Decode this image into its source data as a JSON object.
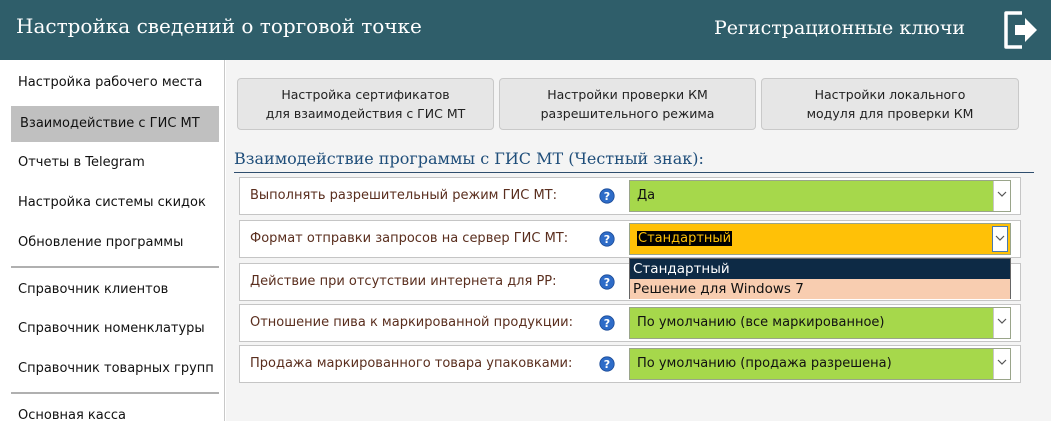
{
  "header": {
    "title": "Настройка сведений о торговой точке",
    "keys_label": "Регистрационные ключи",
    "exit_icon": "exit-door-icon"
  },
  "sidebar": {
    "items": [
      {
        "label": "Настройка рабочего места",
        "active": false
      },
      {
        "label": "Взаимодействие с ГИС МТ",
        "active": true
      },
      {
        "label": "Отчеты в Telegram",
        "active": false
      },
      {
        "label": "Настройка системы скидок",
        "active": false
      },
      {
        "label": "Обновление программы",
        "active": false
      },
      {
        "label": "Справочник клиентов",
        "active": false
      },
      {
        "label": "Справочник номенклатуры",
        "active": false
      },
      {
        "label": "Справочник товарных групп",
        "active": false
      },
      {
        "label": "Основная касса",
        "active": false
      }
    ]
  },
  "tabs": [
    {
      "line1": "Настройка сертификатов",
      "line2": "для взаимодействия с ГИС МТ"
    },
    {
      "line1": "Настройки проверки КМ",
      "line2": "разрешительного режима"
    },
    {
      "line1": "Настройки локального",
      "line2": "модуля для проверки КМ"
    }
  ],
  "section": {
    "title": "Взаимодействие программы с ГИС МТ (Честный знак):"
  },
  "settings": [
    {
      "label": "Выполнять разрешительный режим ГИС МТ:",
      "value": "Да"
    },
    {
      "label": "Формат отправки запросов на сервер ГИС МТ:",
      "value": "Стандартный"
    },
    {
      "label": "Действие при отсутствии интернета для РР:",
      "value": ""
    },
    {
      "label": "Отношение пива к маркированной продукции:",
      "value": "По умолчанию (все маркированное)"
    },
    {
      "label": "Продажа маркированного товара упаковками:",
      "value": "По умолчанию (продажа разрешена)"
    }
  ],
  "dropdown": {
    "options": [
      "Стандартный",
      "Решение для Windows 7"
    ],
    "selected": "Стандартный"
  },
  "colors": {
    "header_bg": "#2f5e6a",
    "select_green": "#a6d84b",
    "select_yellow": "#ffc107",
    "dropdown_selected": "#0d2a45",
    "dropdown_option": "#f8cdb0",
    "label_text": "#5a2e1e",
    "section_title": "#1f4e7a"
  }
}
